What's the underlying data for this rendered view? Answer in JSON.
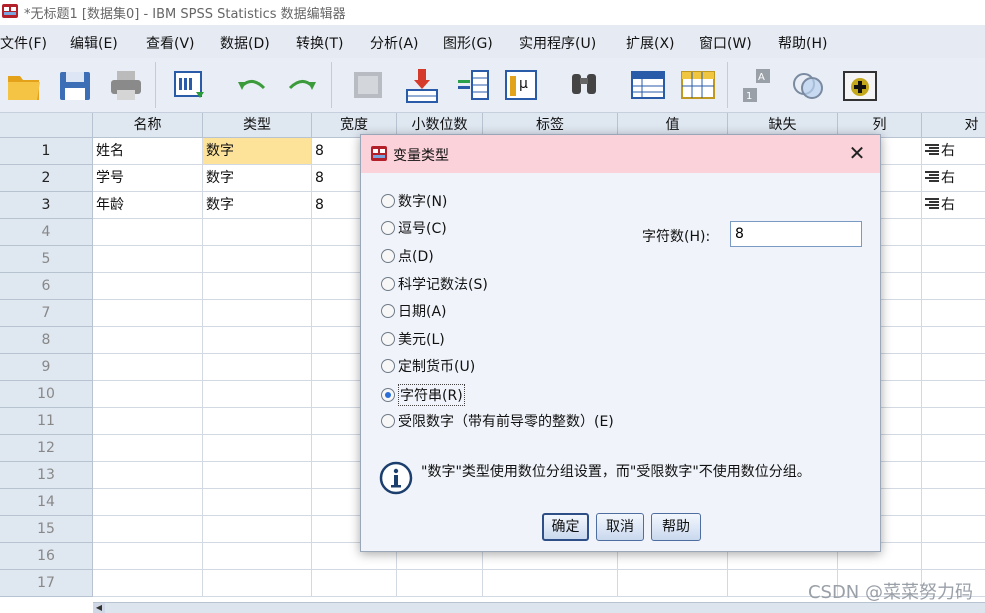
{
  "window": {
    "title": "*无标题1 [数据集0] - IBM SPSS Statistics 数据编辑器"
  },
  "menu": [
    {
      "label": "文件(F)"
    },
    {
      "label": "编辑(E)"
    },
    {
      "label": "查看(V)"
    },
    {
      "label": "数据(D)"
    },
    {
      "label": "转换(T)"
    },
    {
      "label": "分析(A)"
    },
    {
      "label": "图形(G)"
    },
    {
      "label": "实用程序(U)"
    },
    {
      "label": "扩展(X)"
    },
    {
      "label": "窗口(W)"
    },
    {
      "label": "帮助(H)"
    }
  ],
  "toolbar": {
    "icons": [
      "open-folder-icon",
      "save-icon",
      "print-icon",
      "recall-dialog-icon",
      "undo-icon",
      "redo-icon",
      "goto-case-icon",
      "goto-variable-icon",
      "variables-icon",
      "run-descriptives-icon",
      "find-icon",
      "insert-cases-icon",
      "insert-variable-icon",
      "split-file-icon",
      "weight-cases-icon",
      "select-cases-icon",
      "value-labels-icon",
      "use-sets-icon"
    ]
  },
  "grid": {
    "columns": [
      "名称",
      "类型",
      "宽度",
      "小数位数",
      "标签",
      "值",
      "缺失",
      "列",
      "对"
    ],
    "rows": [
      {
        "num": "1",
        "name": "姓名",
        "type": "数字",
        "width": "8",
        "align": "右"
      },
      {
        "num": "2",
        "name": "学号",
        "type": "数字",
        "width": "8",
        "align": "右"
      },
      {
        "num": "3",
        "name": "年龄",
        "type": "数字",
        "width": "8",
        "align": "右"
      }
    ],
    "empty_rows": [
      "4",
      "5",
      "6",
      "7",
      "8",
      "9",
      "10",
      "11",
      "12",
      "13",
      "14",
      "15",
      "16",
      "17"
    ]
  },
  "dialog": {
    "title": "变量类型",
    "options": [
      {
        "label": "数字(N)",
        "selected": false
      },
      {
        "label": "逗号(C)",
        "selected": false
      },
      {
        "label": "点(D)",
        "selected": false
      },
      {
        "label": "科学记数法(S)",
        "selected": false
      },
      {
        "label": "日期(A)",
        "selected": false
      },
      {
        "label": "美元(L)",
        "selected": false
      },
      {
        "label": "定制货币(U)",
        "selected": false
      },
      {
        "label": "字符串(R)",
        "selected": true
      },
      {
        "label": "受限数字（带有前导零的整数）(E)",
        "selected": false
      }
    ],
    "chars_label": "字符数(H):",
    "chars_value": "8",
    "info": "\"数字\"类型使用数位分组设置，而\"受限数字\"不使用数位分组。",
    "ok_label": "确定",
    "cancel_label": "取消",
    "help_label": "帮助"
  },
  "watermark": "CSDN @菜菜努力码"
}
